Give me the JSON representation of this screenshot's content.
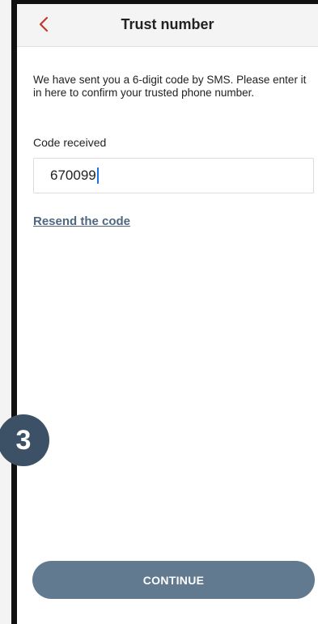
{
  "header": {
    "title": "Trust number",
    "back_icon": "chevron-left-icon",
    "back_color": "#c0392b"
  },
  "main": {
    "instructions": "We have sent you a 6-digit code by SMS. Please enter it in here to confirm your trusted phone number.",
    "code_label": "Code received",
    "code_value": "670099",
    "resend_label": "Resend the code"
  },
  "step_badge": {
    "number": "3"
  },
  "footer": {
    "continue_label": "CONTINUE"
  },
  "colors": {
    "button_bg": "#617a90",
    "link": "#4f6780",
    "badge_bg": "#3d5166"
  }
}
